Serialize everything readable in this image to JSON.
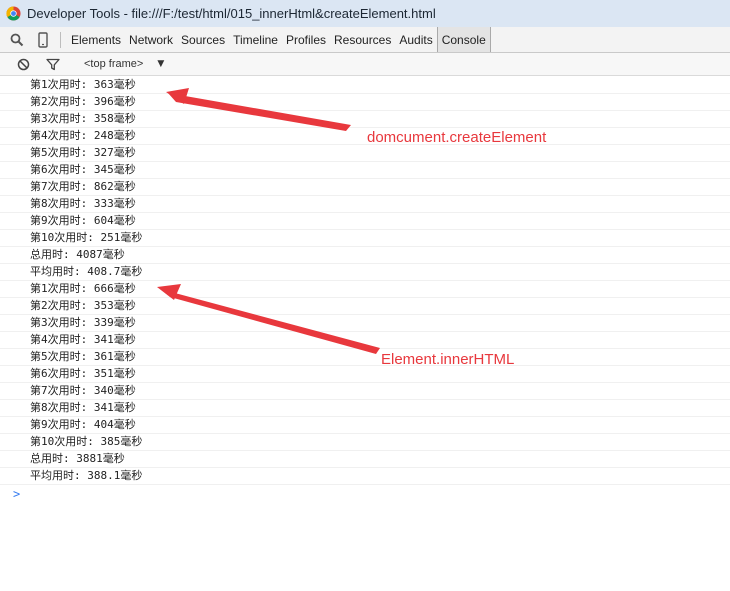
{
  "window": {
    "title": "Developer Tools - file:///F:/test/html/015_innerHtml&createElement.html"
  },
  "toolbar": {
    "tabs": [
      {
        "label": "Elements"
      },
      {
        "label": "Network"
      },
      {
        "label": "Sources"
      },
      {
        "label": "Timeline"
      },
      {
        "label": "Profiles"
      },
      {
        "label": "Resources"
      },
      {
        "label": "Audits"
      },
      {
        "label": "Console"
      }
    ],
    "active_tab": "Console"
  },
  "filterbar": {
    "frame_label": "<top frame>"
  },
  "console": {
    "lines": [
      "第1次用时: 363毫秒",
      "第2次用时: 396毫秒",
      "第3次用时: 358毫秒",
      "第4次用时: 248毫秒",
      "第5次用时: 327毫秒",
      "第6次用时: 345毫秒",
      "第7次用时: 862毫秒",
      "第8次用时: 333毫秒",
      "第9次用时: 604毫秒",
      "第10次用时: 251毫秒",
      "总用时: 4087毫秒",
      "平均用时: 408.7毫秒",
      "第1次用时: 666毫秒",
      "第2次用时: 353毫秒",
      "第3次用时: 339毫秒",
      "第4次用时: 341毫秒",
      "第5次用时: 361毫秒",
      "第6次用时: 351毫秒",
      "第7次用时: 340毫秒",
      "第8次用时: 341毫秒",
      "第9次用时: 404毫秒",
      "第10次用时: 385毫秒",
      "总用时: 3881毫秒",
      "平均用时: 388.1毫秒"
    ],
    "prompt": ">"
  },
  "annotations": {
    "first": "domcument.createElement",
    "second": "Element.innerHTML"
  },
  "colors": {
    "annotation": "#e8383d",
    "prompt": "#367cf1"
  }
}
